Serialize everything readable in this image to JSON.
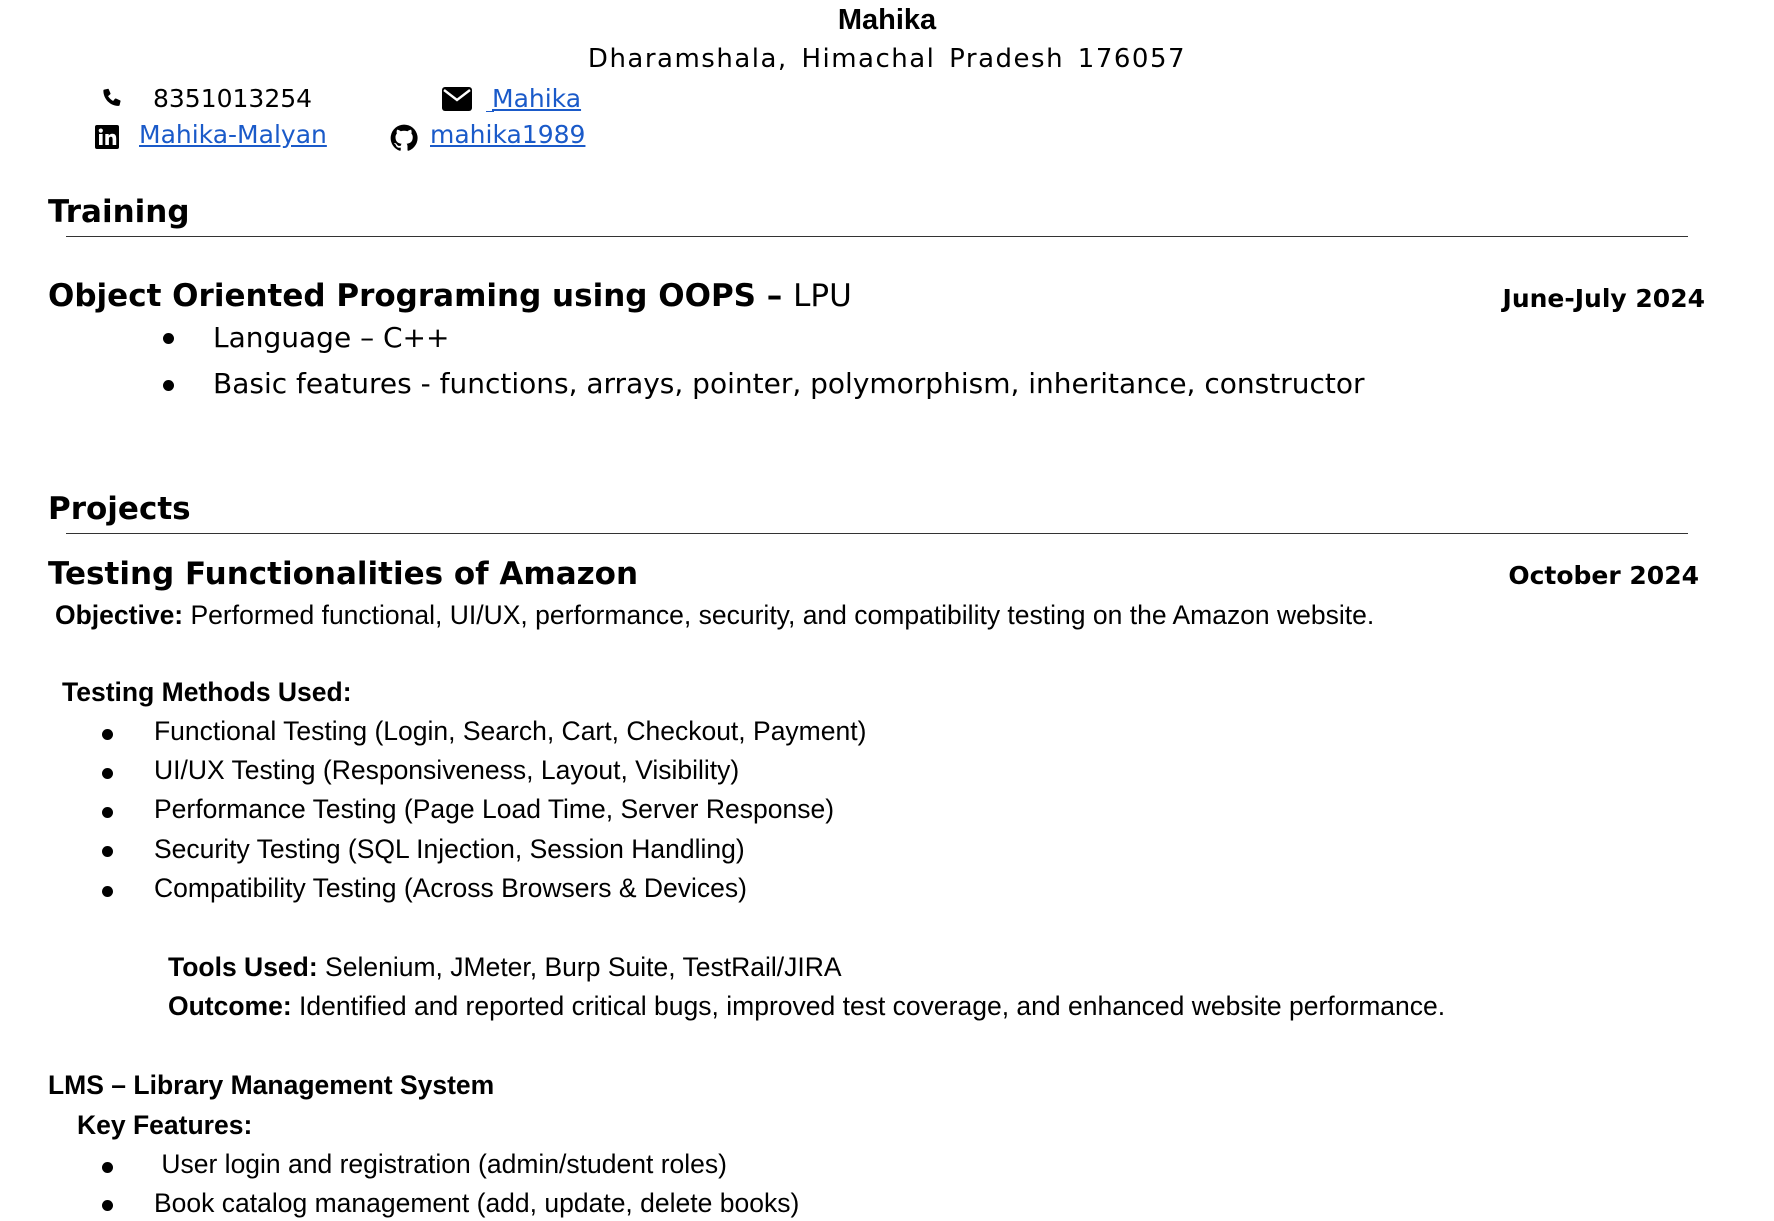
{
  "header": {
    "name": "Mahika",
    "address": "Dharamshala, Himachal Pradesh 176057",
    "phone": "8351013254",
    "email_label": "Mahika",
    "linkedin_label": "Mahika-Malyan",
    "github_label": "mahika1989"
  },
  "training": {
    "heading": "Training",
    "item": {
      "title": "Object Oriented Programing using OOPS",
      "dash": " – ",
      "org": "LPU",
      "date": "June-July 2024",
      "bullets": [
        "Language – C++",
        "Basic features - functions, arrays, pointer, polymorphism, inheritance, constructor"
      ]
    }
  },
  "projects": {
    "heading": "Projects",
    "amazon": {
      "title": "Testing Functionalities of Amazon",
      "date": "October 2024",
      "objective_label": "Objective:",
      "objective_text": " Performed functional, UI/UX, performance, security, and compatibility testing on the Amazon website.",
      "methods_heading": "Testing Methods Used:",
      "methods": [
        "Functional Testing (Login, Search, Cart, Checkout, Payment)",
        "UI/UX Testing (Responsiveness, Layout, Visibility)",
        "Performance Testing (Page Load Time, Server Response)",
        "Security Testing (SQL Injection, Session Handling)",
        "Compatibility Testing (Across Browsers & Devices)"
      ],
      "tools_label": "Tools Used:",
      "tools_text": " Selenium, JMeter, Burp Suite, TestRail/JIRA",
      "outcome_label": "Outcome:",
      "outcome_text": " Identified and reported critical bugs, improved test coverage, and enhanced website performance."
    },
    "lms": {
      "title": "LMS – Library Management System",
      "features_heading": "Key Features:",
      "features": [
        " User login and registration (admin/student roles)",
        "Book catalog management (add, update, delete books)"
      ]
    }
  }
}
